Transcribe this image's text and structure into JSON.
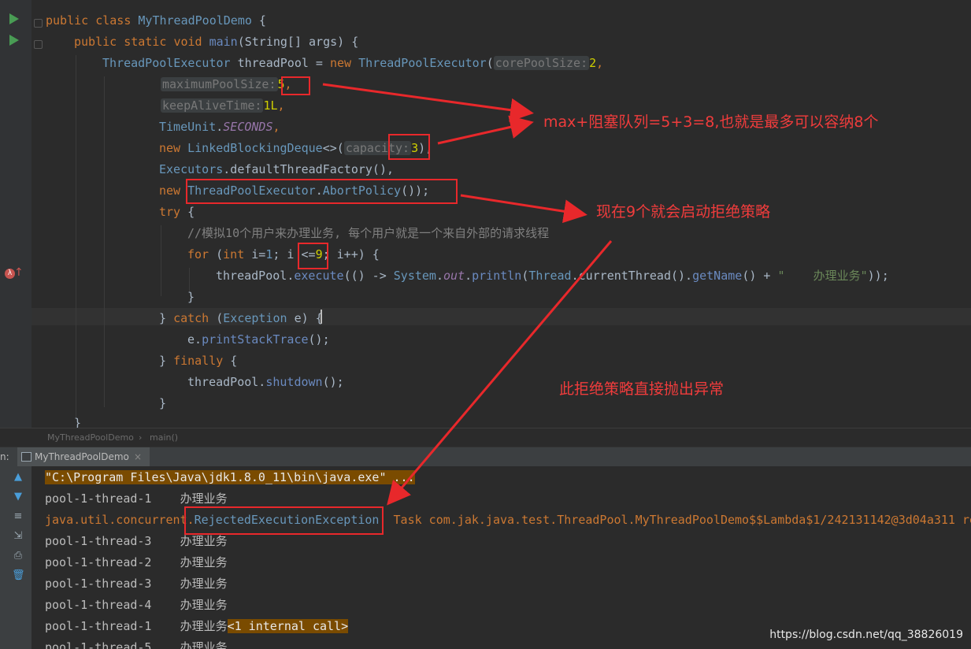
{
  "editor": {
    "lines": {
      "l1": {
        "kw1": "public",
        "kw2": "class",
        "name": "MyThreadPoolDemo",
        "brace": " {"
      },
      "l2": {
        "kw1": "public",
        "kw2": "static",
        "kw3": "void",
        "name": "main",
        "params": "(String[] args) {"
      },
      "l3": {
        "type": "ThreadPoolExecutor",
        "var": " threadPool = ",
        "kw": "new",
        "ctor": " ThreadPoolExecutor",
        "paren": "(",
        "hint": "corePoolSize:",
        "val": "2",
        "tail": ","
      },
      "l4": {
        "hint": "maximumPoolSize:",
        "val": "5",
        "tail": ","
      },
      "l5": {
        "hint": "keepAliveTime:",
        "val": "1L",
        "tail": ","
      },
      "l6": {
        "cls": "TimeUnit",
        "dot": ".",
        "field": "SECONDS",
        "tail": ","
      },
      "l7": {
        "kw": "new",
        "cls": " LinkedBlockingDeque",
        "gen": "<>(",
        "hint": "capacity:",
        "val": "3",
        "tail": "),"
      },
      "l8": {
        "cls": "Executors",
        "rest": ".defaultThreadFactory(),"
      },
      "l9": {
        "kw": "new",
        "cls": " ThreadPoolExecutor",
        "dot": ".",
        "inner": "AbortPolicy",
        "tail": "());"
      },
      "l10": {
        "kw": "try",
        "tail": " {"
      },
      "l11": {
        "comment": "//模拟10个用户来办理业务, 每个用户就是一个来自外部的请求线程"
      },
      "l12": {
        "kw": "for",
        "p1": " (",
        "kw2": "int",
        "p2": " i=",
        "n1": "1",
        "p3": "; i ",
        "op": "<=",
        "n2": "9",
        "p4": "; i++) {"
      },
      "l13": {
        "var": "threadPool",
        "dot": ".",
        "m1": "execute",
        "p1": "(() -> ",
        "cls": "System",
        "dot2": ".",
        "field": "out",
        "dot3": ".",
        "m2": "println",
        "p2": "(",
        "cls2": "Thread",
        "p3": ".currentThread().",
        "m3": "getName",
        "p4": "() + ",
        "str": "\"    办理业务\"",
        "p5": "));"
      },
      "l14": {
        "text": "}"
      },
      "l15": {
        "p1": "} ",
        "kw": "catch",
        "p2": " (",
        "cls": "Exception",
        "p3": " e) {"
      },
      "l16": {
        "var": "e.",
        "m": "printStackTrace",
        "p": "();"
      },
      "l17": {
        "p1": "} ",
        "kw": "finally",
        "p2": " {"
      },
      "l18": {
        "var": "threadPool.",
        "m": "shutdown",
        "p": "();"
      },
      "l19": {
        "text": "}"
      },
      "l20": {
        "text": "}"
      }
    }
  },
  "annotations": {
    "a1": "max+阻塞队列=5+3=8,也就是最多可以容纳8个",
    "a2": "现在9个就会启动拒绝策略",
    "a3": "此拒绝策略直接抛出异常"
  },
  "breadcrumb": {
    "class": "MyThreadPoolDemo",
    "sep": "›",
    "method": "main()"
  },
  "run_panel": {
    "side_label": "n:",
    "tab_label": "MyThreadPoolDemo",
    "tab_close": "×",
    "console": [
      "\"C:\\Program Files\\Java\\jdk1.8.0_11\\bin\\java.exe\" ...",
      "pool-1-thread-1    办理业务",
      "java.util.concurrent.RejectedExecutionException",
      "pool-1-thread-3    办理业务",
      "pool-1-thread-2    办理业务",
      "pool-1-thread-3    办理业务",
      "pool-1-thread-4    办理业务",
      "pool-1-thread-1    办理业务",
      "pool-1-thread-5    办理业务"
    ],
    "error_pre": "java.util.concurrent.",
    "error_cls": "RejectedExecutionException",
    "error_tail": "  Task com.jak.java.test.ThreadPool.MyThreadPoolDemo$$Lambda$1/242131142@3d04a311 re",
    "internal_call": "<1 internal call>"
  },
  "watermark": "https://blog.csdn.net/qq_38826019",
  "colors": {
    "annotation_red": "#e8282b",
    "keyword": "#cc7832",
    "class": "#6897bb"
  }
}
